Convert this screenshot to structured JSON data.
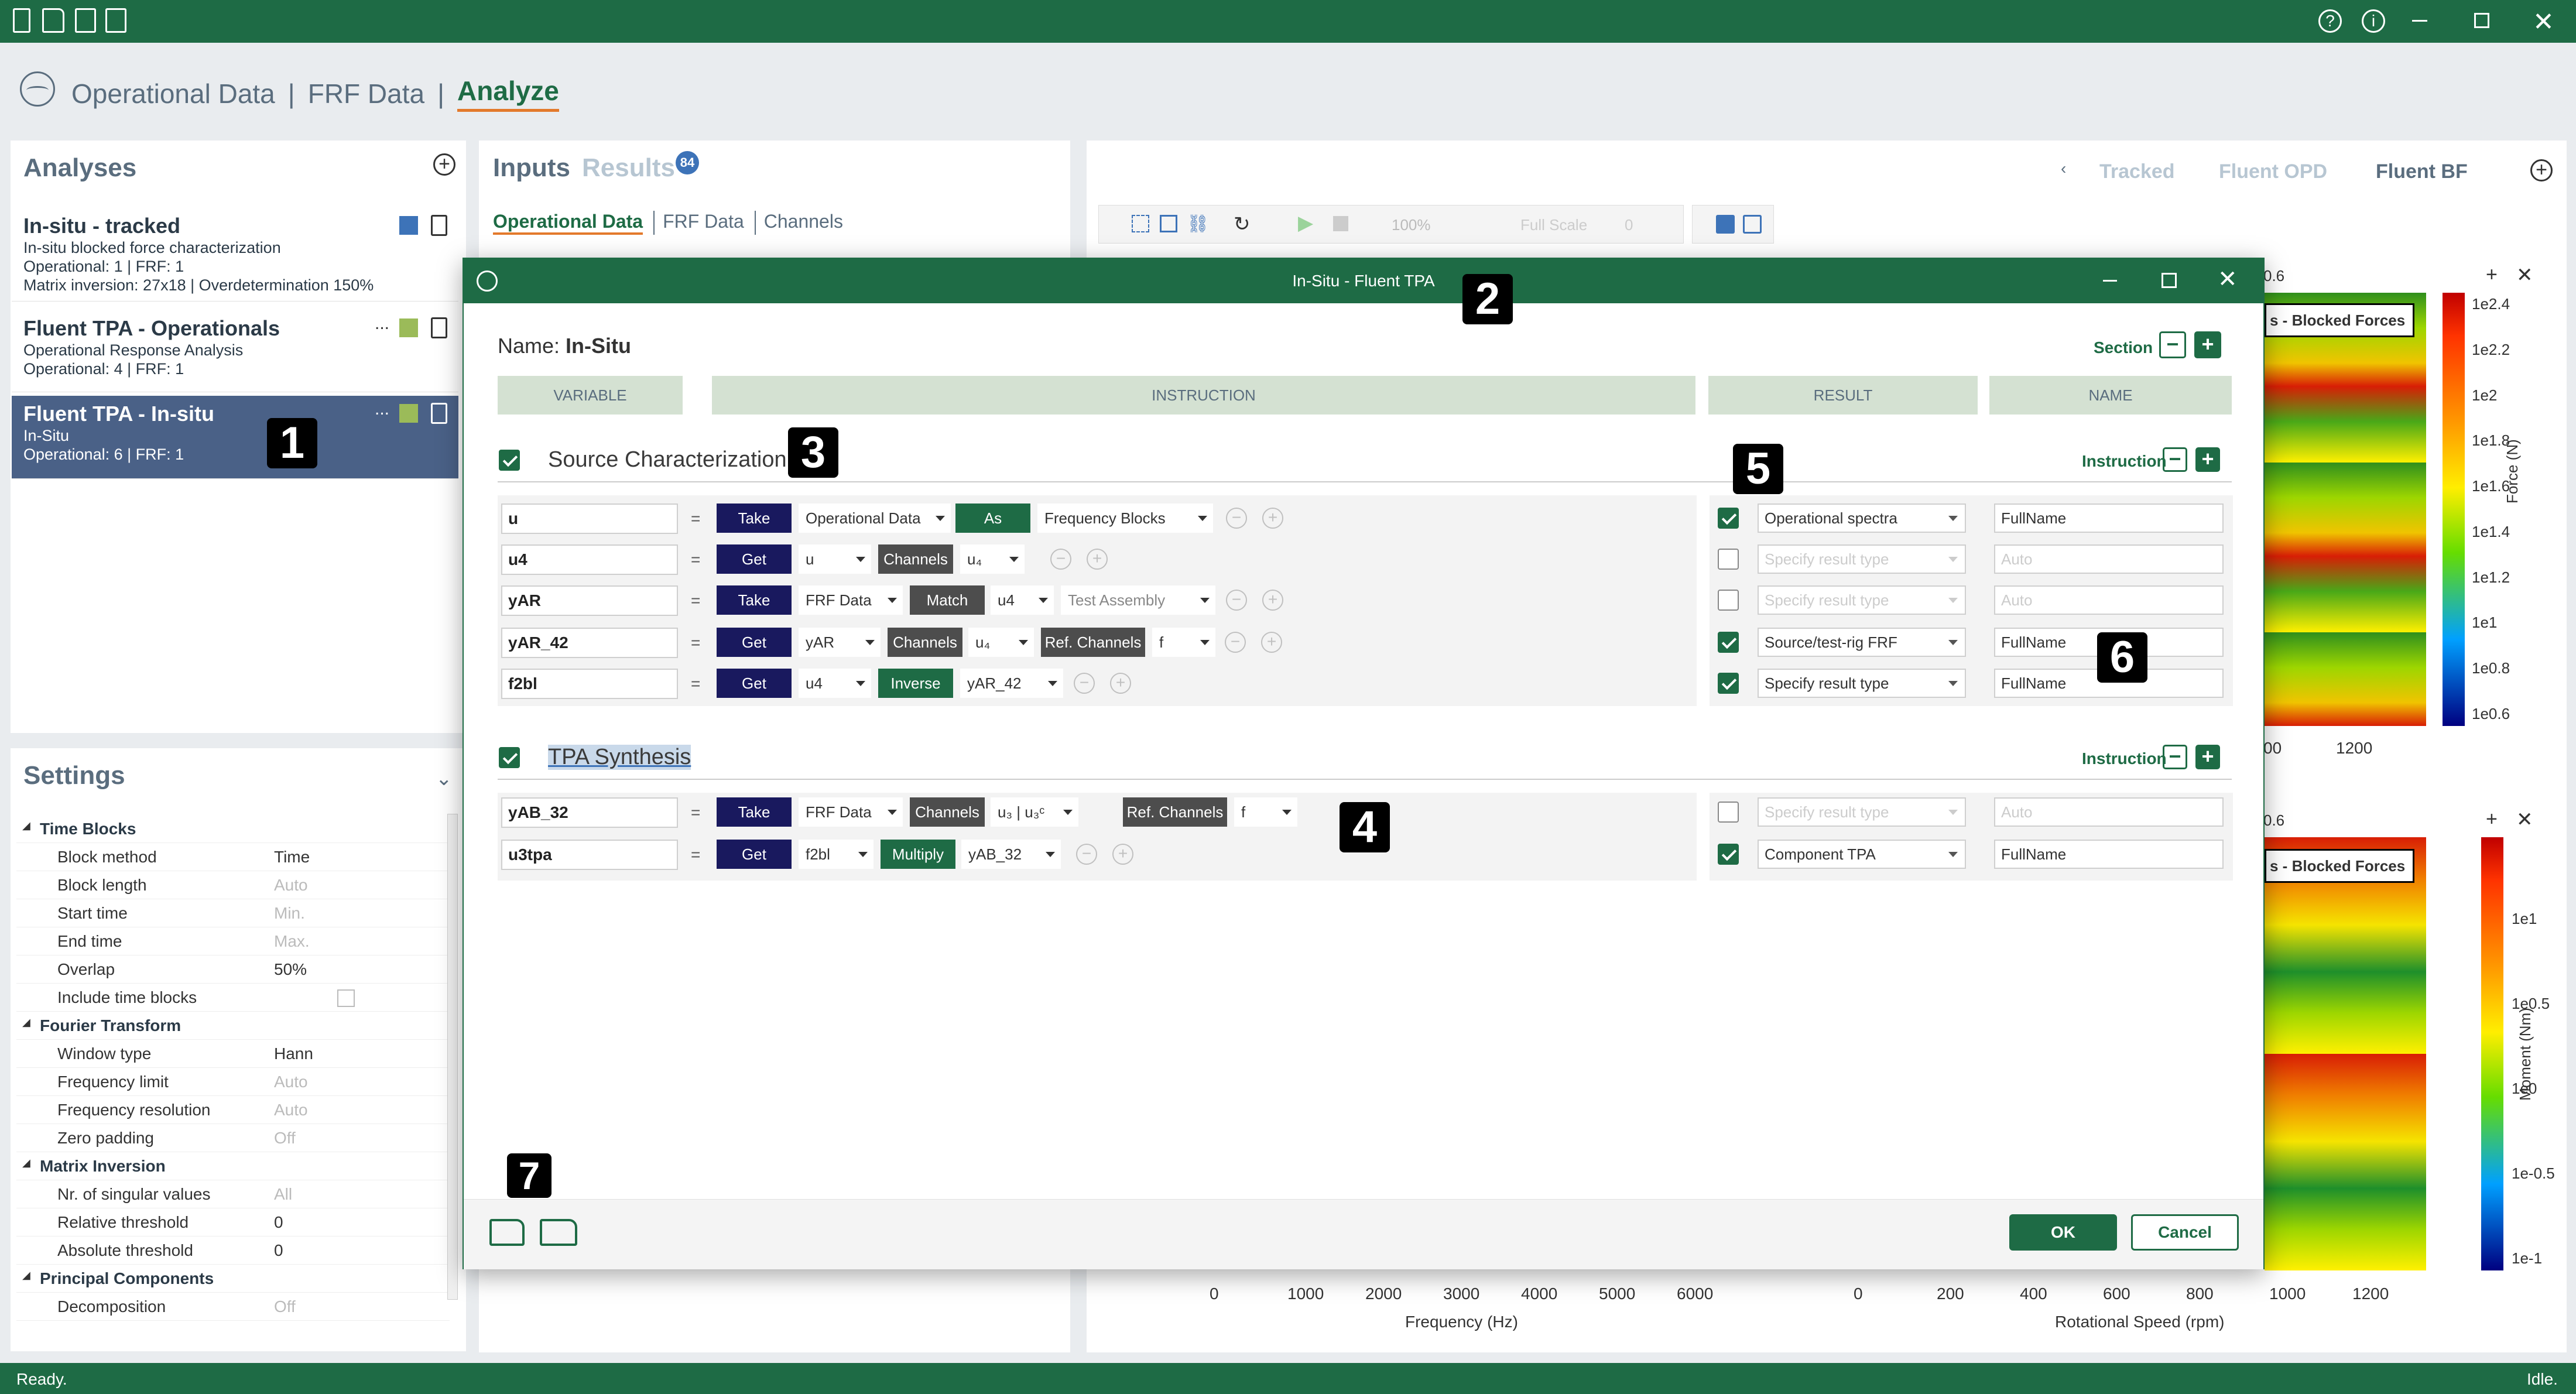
{
  "breadcrumb": {
    "items": [
      "Operational Data",
      "FRF Data",
      "Analyze"
    ],
    "sep": "|"
  },
  "analyses": {
    "title": "Analyses",
    "items": [
      {
        "title": "In-situ - tracked",
        "lines": [
          "In-situ blocked force characterization",
          "Operational: 1 | FRF: 1",
          "Matrix inversion: 27x18 | Overdetermination 150%"
        ],
        "color": "#3d73b8"
      },
      {
        "title": "Fluent TPA - Operationals",
        "lines": [
          "Operational Response Analysis",
          "Operational: 4 | FRF: 1"
        ],
        "color": "#9bbb59"
      },
      {
        "title": "Fluent TPA - In-situ",
        "lines": [
          "In-Situ",
          "Operational: 6 | FRF: 1"
        ],
        "color": "#9bbb59",
        "selected": true
      }
    ],
    "more": "..."
  },
  "settings": {
    "title": "Settings",
    "rows": [
      {
        "group": "Time Blocks"
      },
      {
        "k": "Block method",
        "v": "Time"
      },
      {
        "k": "Block length",
        "v": "Auto",
        "ph": true
      },
      {
        "k": "Start time",
        "v": "Min.",
        "ph": true
      },
      {
        "k": "End time",
        "v": "Max.",
        "ph": true
      },
      {
        "k": "Overlap",
        "v": "50%"
      },
      {
        "k": "Include time blocks",
        "v": ""
      },
      {
        "group": "Fourier Transform"
      },
      {
        "k": "Window type",
        "v": "Hann"
      },
      {
        "k": "Frequency limit",
        "v": "Auto",
        "ph": true
      },
      {
        "k": "Frequency resolution",
        "v": "Auto",
        "ph": true
      },
      {
        "k": "Zero padding",
        "v": "Off",
        "ph": true
      },
      {
        "group": "Matrix Inversion"
      },
      {
        "k": "Nr. of singular values",
        "v": "All",
        "ph": true
      },
      {
        "k": "Relative threshold",
        "v": "0"
      },
      {
        "k": "Absolute threshold",
        "v": "0"
      },
      {
        "group": "Principal Components"
      },
      {
        "k": "Decomposition",
        "v": "Off",
        "ph": true
      }
    ]
  },
  "inputs": {
    "title": "Inputs",
    "results": "Results",
    "results_count": "84",
    "tabs": [
      "Operational Data",
      "FRF Data",
      "Channels"
    ]
  },
  "right": {
    "tabs": [
      "Tracked",
      "Fluent OPD",
      "Fluent BF"
    ],
    "zoom": "100%",
    "fullscale": "Full Scale",
    "fullscale_val": "0"
  },
  "charts": {
    "top": {
      "legend": "s - Blocked Forces",
      "ylabel": "Force (N)",
      "colorbar_ticks": [
        "1e2.4",
        "1e2.2",
        "1e2",
        "1e1.8",
        "1e1.6",
        "1e1.4",
        "1e1.2",
        "1e1",
        "1e0.8",
        "1e0.6"
      ],
      "x_ticks": [
        "00",
        "1200"
      ],
      "range_label": "0.6"
    },
    "bottom": {
      "legend": "s - Blocked Forces",
      "ylabel": "Moment (Nm)",
      "colorbar_ticks": [
        "1e1",
        "1e0.5",
        "1e0",
        "1e-0.5",
        "1e-1"
      ],
      "range_label": "0.6"
    },
    "freq_axis": {
      "label": "Frequency (Hz)",
      "ticks": [
        "0",
        "1000",
        "2000",
        "3000",
        "4000",
        "5000",
        "6000"
      ]
    },
    "rpm_axis": {
      "label": "Rotational Speed (rpm)",
      "ticks": [
        "0",
        "200",
        "400",
        "600",
        "800",
        "1000",
        "1200"
      ]
    }
  },
  "modal": {
    "window_title": "In-Situ - Fluent TPA",
    "name_label": "Name:",
    "name_value": "In-Situ",
    "section_label": "Section",
    "instruction_label": "Instruction",
    "headers": [
      "VARIABLE",
      "INSTRUCTION",
      "RESULT",
      "NAME"
    ],
    "sections": [
      {
        "title": "Source Characterization",
        "rows": [
          {
            "var": "u",
            "op1": "Take",
            "dd1": "Operational Data",
            "op2": "As",
            "dd2": "Frequency Blocks",
            "checked": true,
            "result": "Operational spectra",
            "name": "FullName"
          },
          {
            "var": "u4",
            "op1": "Get",
            "dd1": "u",
            "op2": "Channels",
            "dd2": "u₄",
            "checked": false,
            "result": "Specify result type",
            "name": "Auto"
          },
          {
            "var": "yAR",
            "op1": "Take",
            "dd1": "FRF Data",
            "op2": "Match",
            "dd2": "u4",
            "dd3": "Test Assembly",
            "checked": false,
            "result": "Specify result type",
            "name": "Auto"
          },
          {
            "var": "yAR_42",
            "op1": "Get",
            "dd1": "yAR",
            "op2": "Channels",
            "dd2": "u₄",
            "op3": "Ref. Channels",
            "dd3": "f",
            "checked": true,
            "result": "Source/test-rig FRF",
            "name": "FullName"
          },
          {
            "var": "f2bl",
            "op1": "Get",
            "dd1": "u4",
            "op2": "Inverse",
            "dd2": "yAR_42",
            "checked": true,
            "result": "Specify result type",
            "name": "FullName"
          }
        ]
      },
      {
        "title": "TPA Synthesis",
        "rows": [
          {
            "var": "yAB_32",
            "op1": "Take",
            "dd1": "FRF Data",
            "op2": "Channels",
            "dd2": "u₃ | u₃ᶜ",
            "op3": "Ref. Channels",
            "dd3": "f",
            "checked": false,
            "result": "Specify result type",
            "name": "Auto"
          },
          {
            "var": "u3tpa",
            "op1": "Get",
            "dd1": "f2bl",
            "op2": "Multiply",
            "dd2": "yAB_32",
            "checked": true,
            "result": "Component TPA",
            "name": "FullName"
          }
        ]
      }
    ],
    "ok": "OK",
    "cancel": "Cancel"
  },
  "badges": [
    "1",
    "2",
    "3",
    "4",
    "5",
    "6",
    "7"
  ],
  "status": {
    "left": "Ready.",
    "right": "Idle."
  },
  "colors": {
    "accent": "#1e6b45",
    "orange": "#e3792b",
    "navy": "#19195e",
    "selected": "#4a6187"
  }
}
